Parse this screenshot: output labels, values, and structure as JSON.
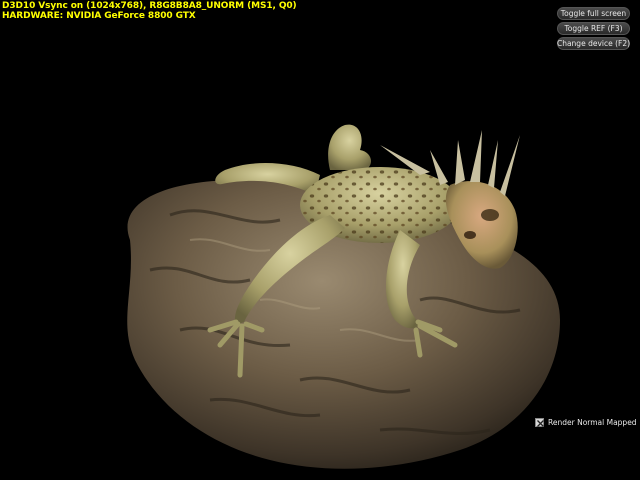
{
  "stats": {
    "line1": "D3D10 Vsync on (1024x768), R8G8B8A8_UNORM (MS1, Q0)",
    "line2": "HARDWARE: NVIDIA GeForce 8800 GTX"
  },
  "buttons": {
    "fullscreen": "Toggle full screen",
    "ref": "Toggle REF (F3)",
    "device": "Change device (F2)"
  },
  "options": {
    "normal_mapped_label": "Render Normal Mapped",
    "normal_mapped_checked": true
  },
  "scene": {
    "background": "#000000",
    "rock_color": "#6a5a44",
    "lizard_color": "#b8b07a",
    "lizard_spot_color": "#4a3a1a"
  }
}
